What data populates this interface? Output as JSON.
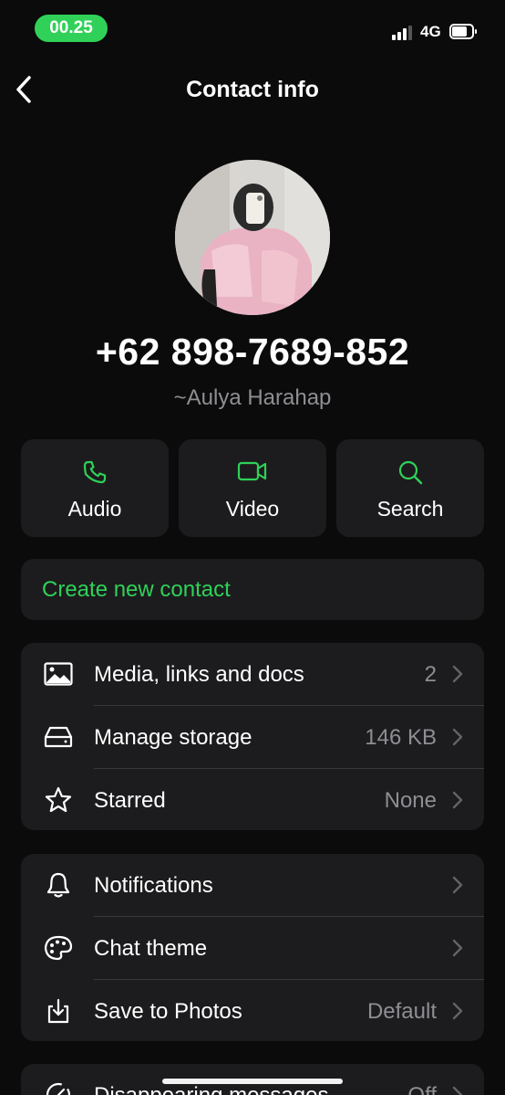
{
  "status_bar": {
    "time": "00.25",
    "network": "4G"
  },
  "header": {
    "title": "Contact info"
  },
  "contact": {
    "phone": "+62 898-7689-852",
    "name": "~Aulya Harahap"
  },
  "actions": [
    {
      "label": "Audio",
      "icon": "phone-icon"
    },
    {
      "label": "Video",
      "icon": "video-icon"
    },
    {
      "label": "Search",
      "icon": "search-icon"
    }
  ],
  "create_contact": {
    "label": "Create new contact"
  },
  "media_group": [
    {
      "label": "Media, links and docs",
      "value": "2",
      "icon": "image-icon"
    },
    {
      "label": "Manage storage",
      "value": "146 KB",
      "icon": "storage-icon"
    },
    {
      "label": "Starred",
      "value": "None",
      "icon": "star-icon"
    }
  ],
  "settings_group": [
    {
      "label": "Notifications",
      "value": "",
      "icon": "bell-icon"
    },
    {
      "label": "Chat theme",
      "value": "",
      "icon": "palette-icon"
    },
    {
      "label": "Save to Photos",
      "value": "Default",
      "icon": "download-icon"
    }
  ],
  "disappearing": {
    "label": "Disappearing messages",
    "value": "Off",
    "icon": "timer-icon"
  },
  "colors": {
    "accent": "#30d158",
    "background": "#0b0b0b",
    "card": "#1c1c1e",
    "secondary_text": "#8e8e93"
  }
}
